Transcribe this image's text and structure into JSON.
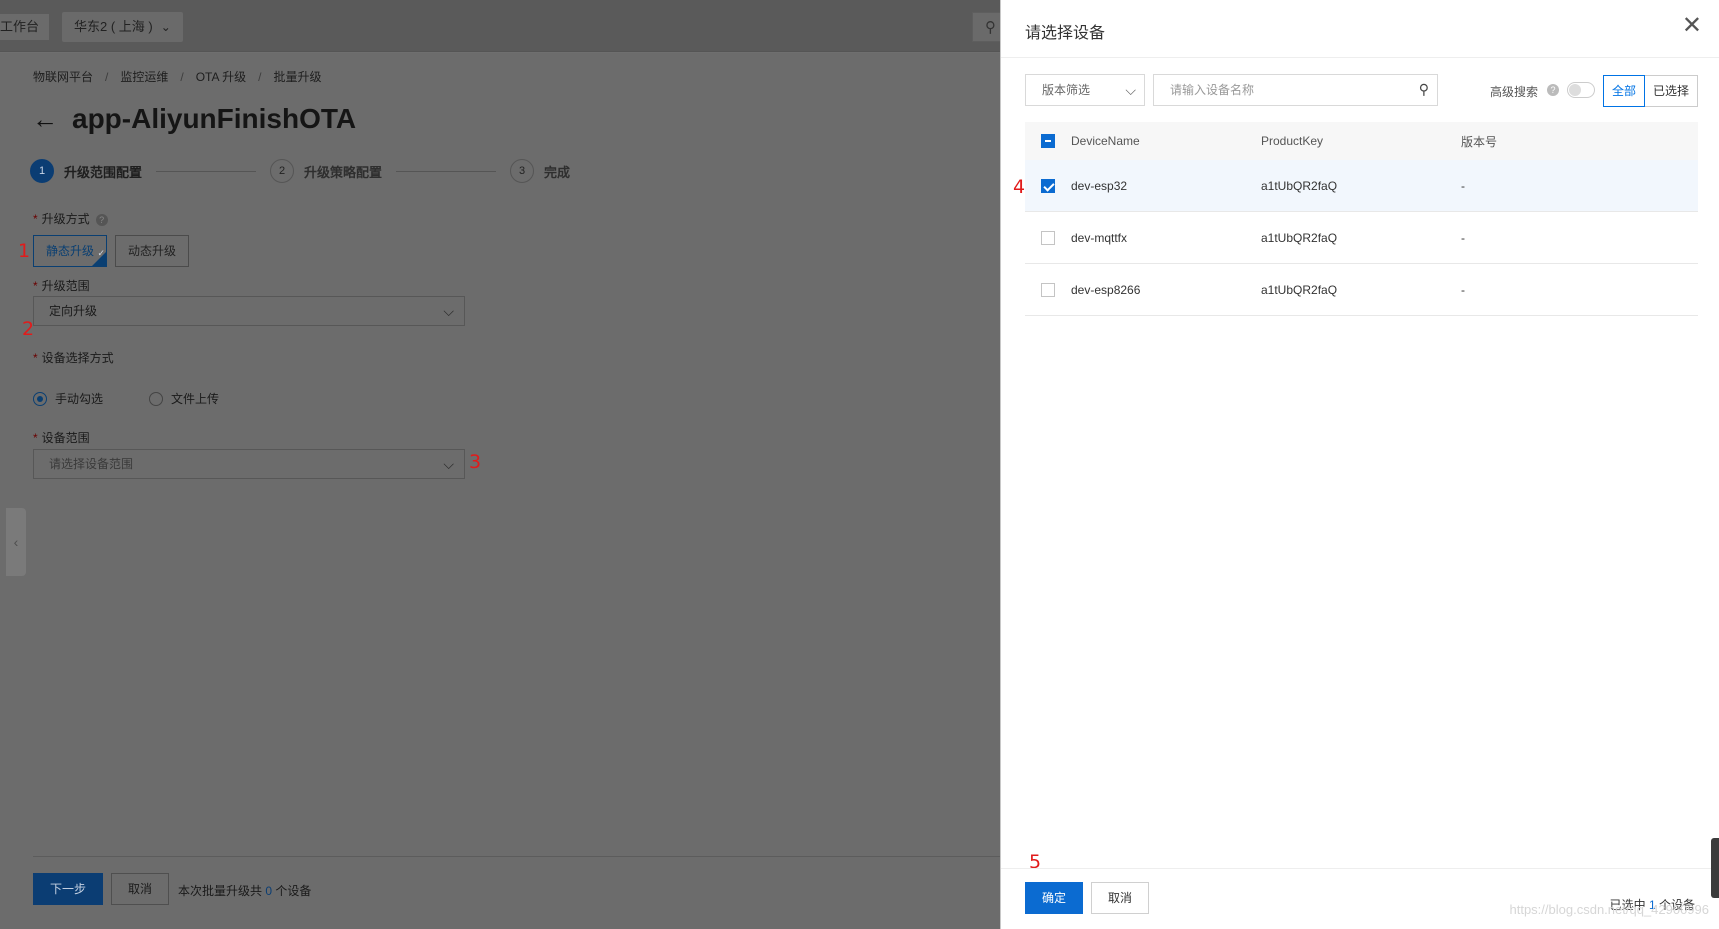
{
  "topbar": {
    "workspace": "工作台",
    "region": "华东2 ( 上海 )"
  },
  "breadcrumb": [
    "物联网平台",
    "监控运维",
    "OTA 升级",
    "批量升级"
  ],
  "page_title": "app-AliyunFinishOTA",
  "steps": [
    {
      "num": "1",
      "label": "升级范围配置"
    },
    {
      "num": "2",
      "label": "升级策略配置"
    },
    {
      "num": "3",
      "label": "完成"
    }
  ],
  "form": {
    "upgrade_mode_label": "升级方式",
    "mode_static": "静态升级",
    "mode_dynamic": "动态升级",
    "range_label": "升级范围",
    "range_value": "定向升级",
    "select_method_label": "设备选择方式",
    "method_manual": "手动勾选",
    "method_file": "文件上传",
    "device_range_label": "设备范围",
    "device_range_placeholder": "请选择设备范围"
  },
  "footer": {
    "next": "下一步",
    "cancel": "取消",
    "note_prefix": "本次批量升级共 ",
    "note_count": "0",
    "note_suffix": " 个设备"
  },
  "annotations": [
    "1",
    "2",
    "3",
    "4",
    "5"
  ],
  "drawer": {
    "title": "请选择设备",
    "version_filter": "版本筛选",
    "search_placeholder": "请输入设备名称",
    "advanced_search": "高级搜索",
    "seg_all": "全部",
    "seg_selected": "已选择",
    "columns": [
      "DeviceName",
      "ProductKey",
      "版本号"
    ],
    "rows": [
      {
        "name": "dev-esp32",
        "key": "a1tUbQR2faQ",
        "version": "-",
        "checked": true
      },
      {
        "name": "dev-mqttfx",
        "key": "a1tUbQR2faQ",
        "version": "-",
        "checked": false
      },
      {
        "name": "dev-esp8266",
        "key": "a1tUbQR2faQ",
        "version": "-",
        "checked": false
      }
    ],
    "ok": "确定",
    "cancel": "取消",
    "selected_prefix": "已选中 ",
    "selected_count": "1",
    "selected_suffix": " 个设备",
    "watermark": "https://blog.csdn.net/qq_42900996"
  },
  "colors": {
    "primary": "#0b6bd1",
    "annotation": "#e11b1b",
    "overlay_bg": "#6c6c6c"
  }
}
